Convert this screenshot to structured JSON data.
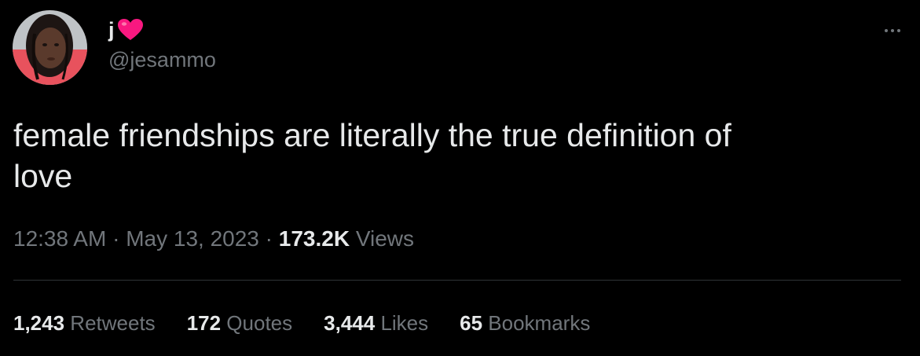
{
  "author": {
    "display_name": "j",
    "name_emoji_icon": "red-heart-icon",
    "handle": "@jesammo",
    "avatar_icon": "profile-photo"
  },
  "more_icon": "ellipsis-icon",
  "tweet": {
    "text": "female friendships are literally the true definition of\nlove"
  },
  "meta": {
    "time": "12:38 AM",
    "separator": " · ",
    "date": "May 13, 2023",
    "views_count": "173.2K",
    "views_label": " Views"
  },
  "stats": {
    "retweets": {
      "count": "1,243",
      "label": " Retweets"
    },
    "quotes": {
      "count": "172",
      "label": " Quotes"
    },
    "likes": {
      "count": "3,444",
      "label": " Likes"
    },
    "bookmarks": {
      "count": "65",
      "label": " Bookmarks"
    }
  },
  "colors": {
    "background": "#000000",
    "primary_text": "#e7e9ea",
    "secondary_text": "#71767b",
    "divider": "#2f3336",
    "heart": "#f91880"
  }
}
